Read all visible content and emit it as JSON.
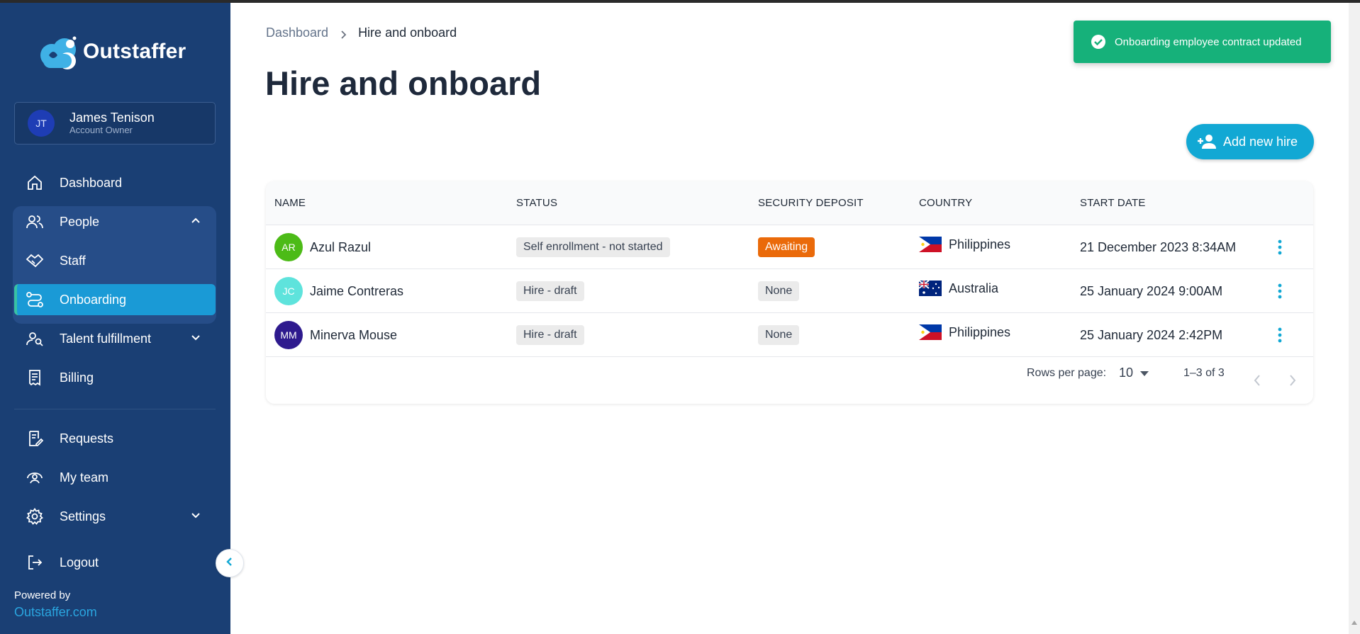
{
  "app": {
    "brand_name": "Outstaffer",
    "powered_by_label": "Powered by",
    "powered_by_link": "Outstaffer.com"
  },
  "user": {
    "initials": "JT",
    "name": "James Tenison",
    "role": "Account Owner"
  },
  "sidebar": {
    "items": [
      {
        "label": "Dashboard",
        "icon": "home-icon"
      },
      {
        "label": "People",
        "icon": "people-icon",
        "expanded": true
      },
      {
        "label": "Staff",
        "icon": "staff-handshake-icon"
      },
      {
        "label": "Onboarding",
        "icon": "onboarding-route-icon",
        "active": true
      },
      {
        "label": "Talent fulfillment",
        "icon": "talent-search-icon"
      },
      {
        "label": "Billing",
        "icon": "receipt-icon"
      },
      {
        "label": "Requests",
        "icon": "requests-icon"
      },
      {
        "label": "My team",
        "icon": "team-icon"
      },
      {
        "label": "Settings",
        "icon": "gear-icon"
      },
      {
        "label": "Logout",
        "icon": "logout-icon"
      }
    ]
  },
  "breadcrumb": {
    "parent": "Dashboard",
    "current": "Hire and onboard"
  },
  "page": {
    "title": "Hire and onboard",
    "add_button": "Add new hire"
  },
  "table": {
    "columns": [
      "NAME",
      "STATUS",
      "SECURITY DEPOSIT",
      "COUNTRY",
      "START DATE"
    ],
    "rows": [
      {
        "initials": "AR",
        "avatar_color": "#4cbb17",
        "name": "Azul Razul",
        "status": "Self enrollment - not started",
        "deposit": "Awaiting",
        "deposit_style": "warning",
        "country": "Philippines",
        "start_date": "21 December 2023 8:34AM"
      },
      {
        "initials": "JC",
        "avatar_color": "#5ee3dc",
        "name": "Jaime Contreras",
        "status": "Hire - draft",
        "deposit": "None",
        "deposit_style": "neutral",
        "country": "Australia",
        "start_date": "25 January 2024 9:00AM"
      },
      {
        "initials": "MM",
        "avatar_color": "#2e1a8e",
        "name": "Minerva Mouse",
        "status": "Hire - draft",
        "deposit": "None",
        "deposit_style": "neutral",
        "country": "Philippines",
        "start_date": "25 January 2024 2:42PM"
      }
    ]
  },
  "pagination": {
    "rows_per_page_label": "Rows per page:",
    "rows_per_page": "10",
    "range": "1–3 of 3"
  },
  "toast": {
    "message": "Onboarding employee contract updated",
    "color": "#16b17a"
  },
  "colors": {
    "sidebar_bg": "#1a3f74",
    "accent": "#12a8d4",
    "active_item": "#1a9ad6"
  }
}
